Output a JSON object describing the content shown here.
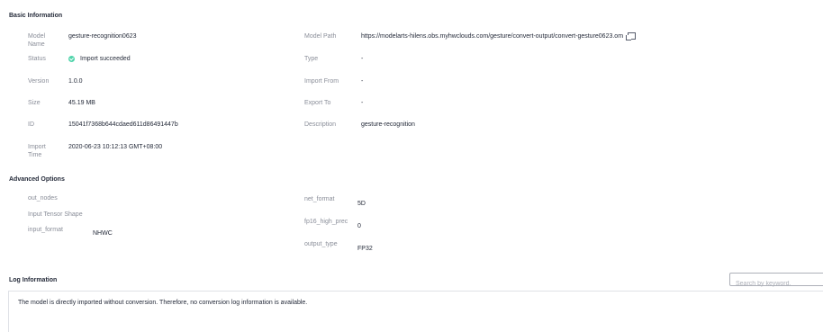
{
  "basic": {
    "title": "Basic Information",
    "model_name_label": "Model Name",
    "model_name": "gesture-recognition0623",
    "status_label": "Status",
    "status": "Import succeeded",
    "version_label": "Version",
    "version": "1.0.0",
    "size_label": "Size",
    "size": "45.19 MB",
    "id_label": "ID",
    "id": "15041f7368b644cdaed611d86491447b",
    "import_time_label": "Import Time",
    "import_time": "2020-06-23 10:12:13 GMT+08:00",
    "model_path_label": "Model Path",
    "model_path": "https://modelarts-hilens.obs.myhwclouds.com/gesture/convert-output/convert-gesture0623.om",
    "type_label": "Type",
    "type": "-",
    "import_from_label": "Import From",
    "import_from": "-",
    "export_to_label": "Export To",
    "export_to": "-",
    "description_label": "Description",
    "description": "gesture-recognition"
  },
  "advanced": {
    "title": "Advanced Options",
    "out_nodes_label": "out_nodes",
    "input_tensor_shape_label": "Input Tensor Shape",
    "input_format_label": "input_format",
    "input_format": "NHWC",
    "net_format_label": "net_format",
    "net_format": "5D",
    "fp16_label": "fp16_high_prec",
    "fp16": "0",
    "output_type_label": "output_type",
    "output_type": "FP32"
  },
  "log": {
    "title": "Log Information",
    "search_placeholder": "Search by keyword.",
    "message": "The model is directly imported without conversion. Therefore, no conversion log information is available."
  },
  "colors": {
    "success": "#50d4ab"
  },
  "icons": [
    "success-check-icon",
    "copy-icon",
    "search-icon"
  ]
}
